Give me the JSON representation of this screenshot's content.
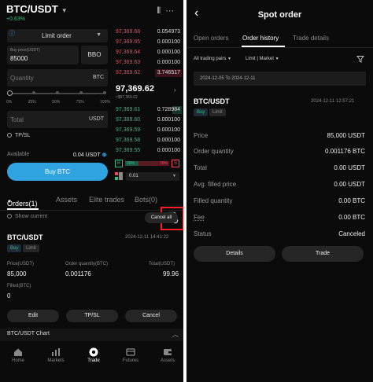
{
  "left": {
    "header": {
      "pair": "BTC/USDT",
      "change": "+0.63%"
    },
    "form": {
      "order_type": "Limit order",
      "price_label": "Buy price(USDT)",
      "price_value": "85000",
      "bbo_label": "BBO",
      "quantity_placeholder": "Quantity",
      "quantity_unit": "BTC",
      "percent_marks": [
        "0%",
        "25%",
        "50%",
        "75%",
        "100%"
      ],
      "total_placeholder": "Total",
      "total_unit": "USDT",
      "tpsl_label": "TP/SL",
      "available_label": "Available",
      "available_value": "0.04 USDT",
      "buy_button": "Buy BTC"
    },
    "order_book": {
      "asks": [
        {
          "price": "97,369.68",
          "qty": "0.054973"
        },
        {
          "price": "97,369.65",
          "qty": "0.000100"
        },
        {
          "price": "97,369.64",
          "qty": "0.000100"
        },
        {
          "price": "97,369.63",
          "qty": "0.000100"
        },
        {
          "price": "97,369.62",
          "qty": "3.746517"
        }
      ],
      "mid_price": "97,369.62",
      "mid_sub": "≈$97,369.62",
      "bids": [
        {
          "price": "97,369.61",
          "qty": "0.728984"
        },
        {
          "price": "97,369.60",
          "qty": "0.000100"
        },
        {
          "price": "97,369.59",
          "qty": "0.000100"
        },
        {
          "price": "97,369.58",
          "qty": "0.000100"
        },
        {
          "price": "97,369.55",
          "qty": "0.000100"
        }
      ],
      "buy_ratio_label": "B",
      "sell_ratio_label": "S",
      "buy_pct": "30%",
      "sell_pct": "70%",
      "depth": "0.01"
    },
    "tabs": {
      "orders": "Orders(1)",
      "assets": "Assets",
      "elite": "Elite trades",
      "bots": "Bots(0)"
    },
    "show_current": "Show current",
    "cancel_all": "Cancel all",
    "order": {
      "pair": "BTC/USDT",
      "time": "2024-12-11 14:41:22",
      "side": "Buy",
      "type": "Limit",
      "price_label": "Price(USDT)",
      "price_value": "85,000",
      "qty_label": "Order quantity(BTC)",
      "qty_value": "0.001176",
      "total_label": "Total(USDT)",
      "total_value": "99.96",
      "filled_label": "Filled(BTC)",
      "filled_value": "0",
      "edit": "Edit",
      "tpsl": "TP/SL",
      "cancel": "Cancel"
    },
    "chart_bar": "BTC/USDT  Chart",
    "nav": [
      {
        "label": "Home",
        "icon": "home-icon"
      },
      {
        "label": "Markets",
        "icon": "markets-icon"
      },
      {
        "label": "Trade",
        "icon": "trade-icon"
      },
      {
        "label": "Futures",
        "icon": "futures-icon"
      },
      {
        "label": "Assets",
        "icon": "wallet-icon"
      }
    ]
  },
  "right": {
    "title": "Spot order",
    "tabs": [
      "Open orders",
      "Order history",
      "Trade details"
    ],
    "filter_pairs": "All trading pairs",
    "filter_type": "Limit | Market",
    "date_range": "2024-12-05 To 2024-12-11",
    "pair": "BTC/USDT",
    "time": "2024-12-11 12:57:21",
    "side": "Buy",
    "type": "Limit",
    "rows": [
      {
        "label": "Price",
        "value": "85,000 USDT"
      },
      {
        "label": "Order quantity",
        "value": "0.001176 BTC"
      },
      {
        "label": "Total",
        "value": "0.00 USDT"
      },
      {
        "label": "Avg. filled price",
        "value": "0.00 USDT"
      },
      {
        "label": "Filled quantity",
        "value": "0.00 BTC"
      },
      {
        "label": "Fee",
        "value": "0.00 BTC"
      },
      {
        "label": "Status",
        "value": "Canceled"
      }
    ],
    "details_button": "Details",
    "trade_button": "Trade"
  },
  "colors": {
    "accent": "#2fa4e0",
    "green": "#2ebd85",
    "red": "#f6465d",
    "highlight": "#ff1e1e"
  }
}
